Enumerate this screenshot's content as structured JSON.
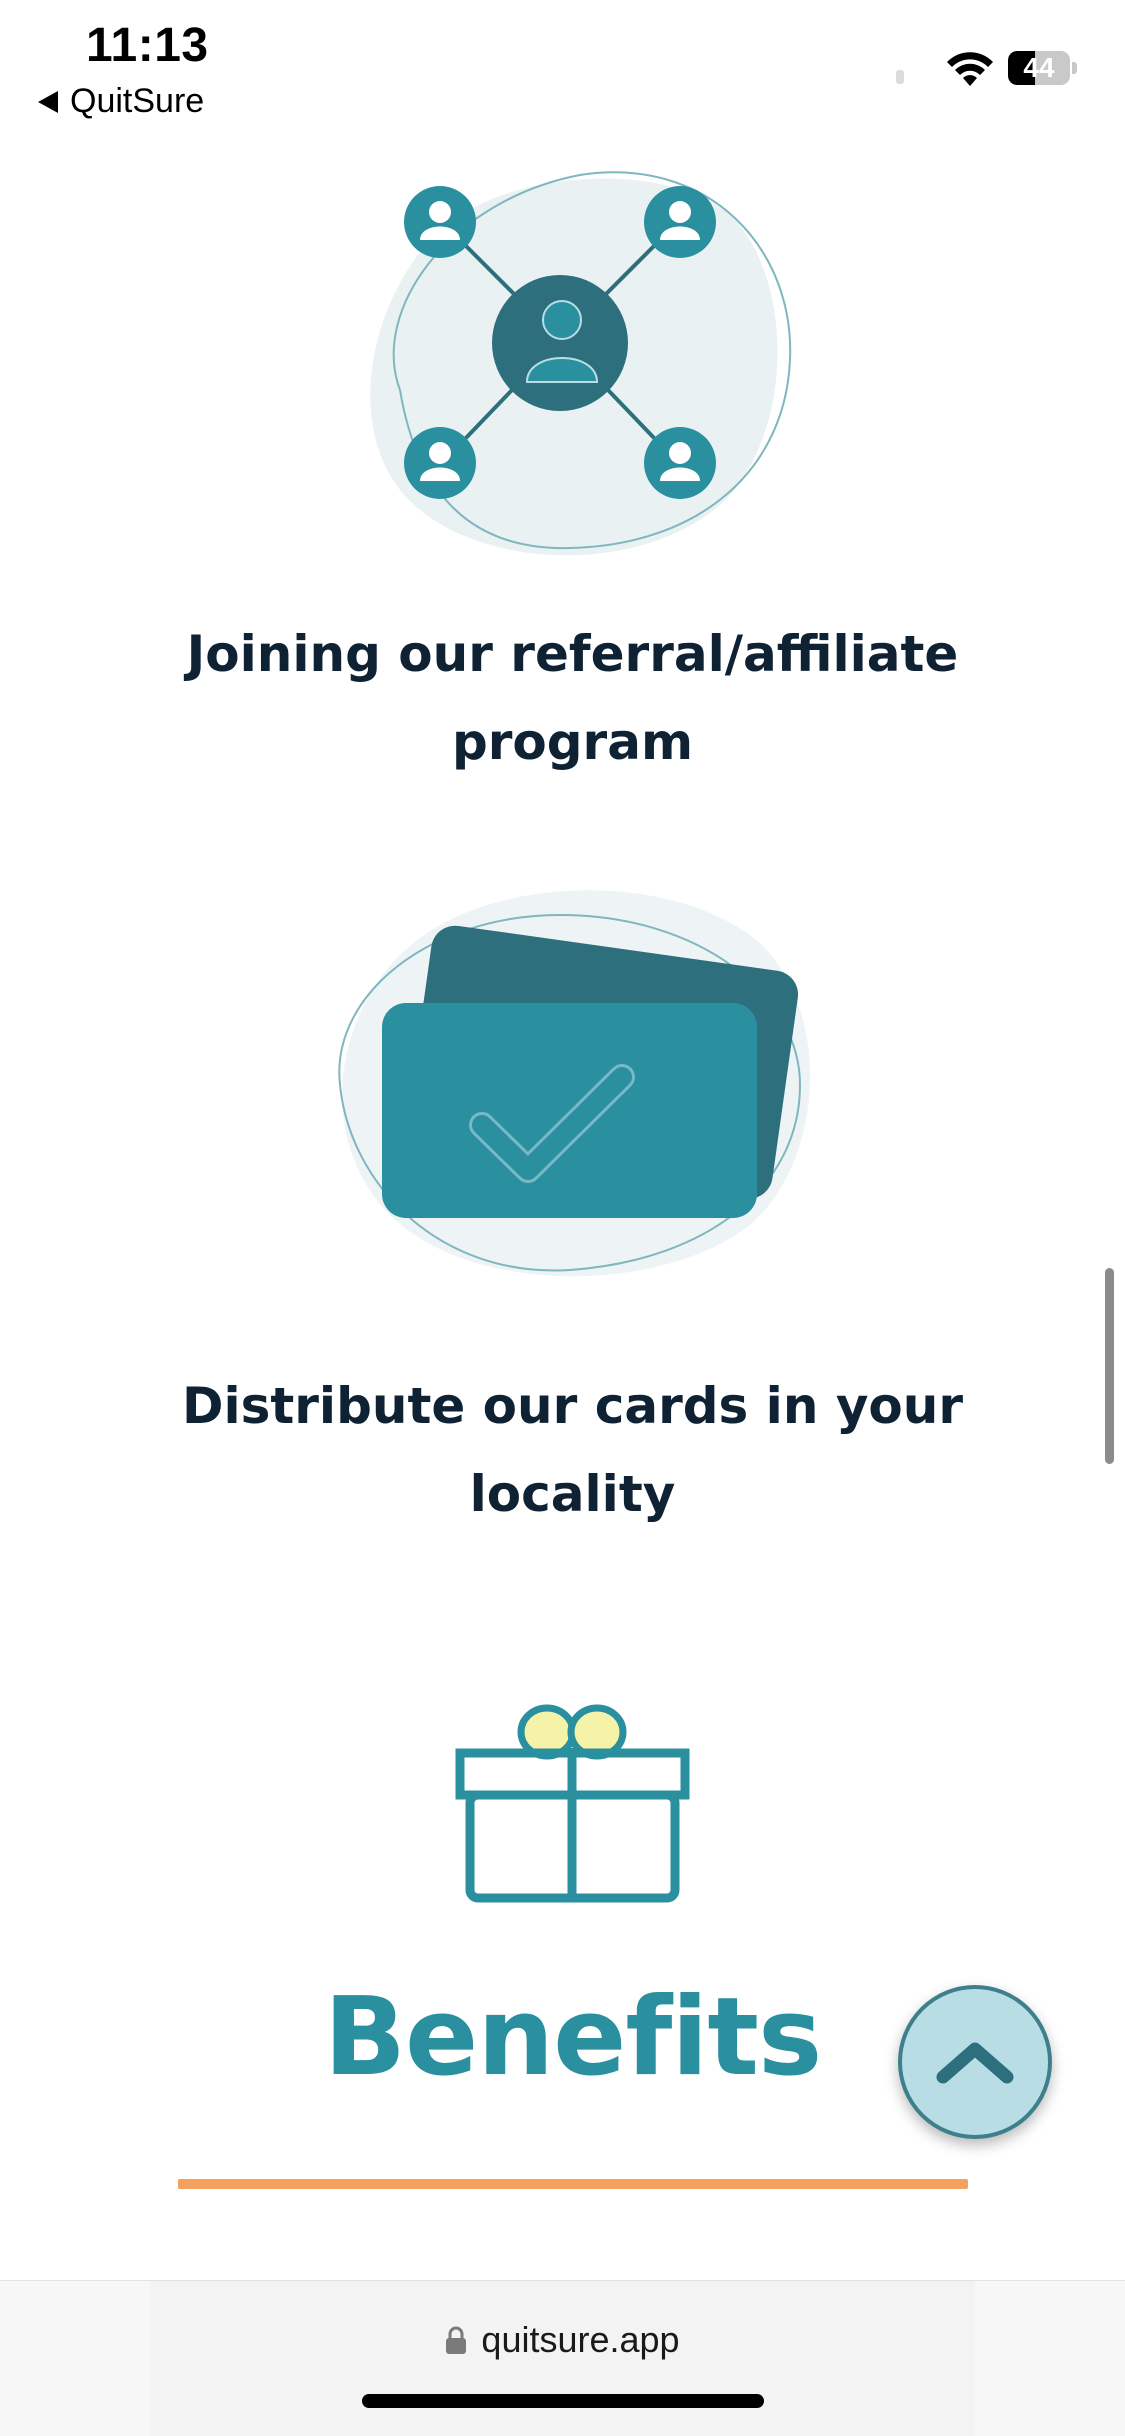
{
  "status_bar": {
    "time": "11:13",
    "back_app": "QuitSure",
    "battery_level": "44",
    "battery_fraction": 0.44
  },
  "items": [
    {
      "title": "Joining our referral/affiliate program",
      "icon": "referral-network-icon"
    },
    {
      "title": "Distribute our cards in your locality",
      "icon": "card-check-icon"
    }
  ],
  "benefits": {
    "heading": "Benefits",
    "icon": "gift-icon"
  },
  "scroll_top": {
    "icon": "chevron-up-icon"
  },
  "browser": {
    "url": "quitsure.app"
  },
  "colors": {
    "teal": "#2a8f9f",
    "dark_teal": "#2e6f7d",
    "heading_text": "#0f2233",
    "accent_orange": "#f4a05e",
    "gift_bow": "#f5f3a8"
  }
}
